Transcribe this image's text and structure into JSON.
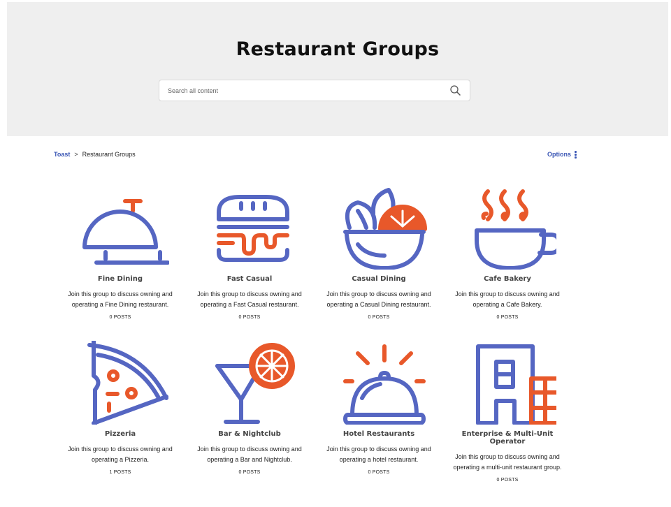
{
  "page": {
    "title": "Restaurant Groups"
  },
  "search": {
    "placeholder": "Search all content"
  },
  "breadcrumb": {
    "root": "Toast",
    "separator": ">",
    "current": "Restaurant Groups"
  },
  "options": {
    "label": "Options"
  },
  "colors": {
    "accent": "#3b57b5",
    "icon_blue": "#5566c2",
    "icon_orange": "#e8582a",
    "hero_bg": "#efefef"
  },
  "groups": [
    {
      "name": "Fine Dining",
      "desc1": "Join this group to discuss owning and",
      "desc2": "operating a Fine Dining restaurant.",
      "posts": "0 POSTS",
      "icon": "service-bell-icon"
    },
    {
      "name": "Fast Casual",
      "desc1": "Join this group to discuss owning and",
      "desc2": "operating a Fast Casual restaurant.",
      "posts": "0 POSTS",
      "icon": "burger-icon"
    },
    {
      "name": "Casual Dining",
      "desc1": "Join this group to discuss owning and",
      "desc2": "operating a Casual Dining restaurant.",
      "posts": "0 POSTS",
      "icon": "salad-bowl-icon"
    },
    {
      "name": "Cafe Bakery",
      "desc1": "Join this group to discuss owning and",
      "desc2": "operating a Cafe Bakery.",
      "posts": "0 POSTS",
      "icon": "coffee-cup-icon"
    },
    {
      "name": "Pizzeria",
      "desc1": "Join this group to discuss owning and",
      "desc2": "operating a Pizzeria.",
      "posts": "1 POSTS",
      "icon": "pizza-slice-icon"
    },
    {
      "name": "Bar & Nightclub",
      "desc1": "Join this group to discuss owning and",
      "desc2": "operating a Bar and Nightclub.",
      "posts": "0 POSTS",
      "icon": "cocktail-icon"
    },
    {
      "name": "Hotel Restaurants",
      "desc1": "Join this group to discuss owning and",
      "desc2": "operating a hotel restaurant.",
      "posts": "0 POSTS",
      "icon": "cloche-icon"
    },
    {
      "name": "Enterprise & Multi-Unit Operator",
      "desc1": "Join this group to discuss owning and",
      "desc2": "operating a multi-unit restaurant group.",
      "posts": "0 POSTS",
      "icon": "buildings-icon"
    }
  ]
}
